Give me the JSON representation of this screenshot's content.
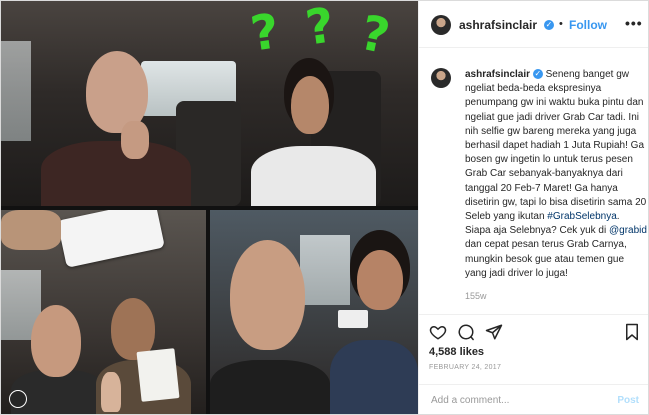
{
  "post": {
    "username": "ashrafsinclair",
    "verified_symbol": "✓",
    "separator": "•",
    "follow_label": "Follow",
    "more_symbol": "•••",
    "caption_prefix": "Seneng banget gw ngeliat beda-beda ekspresinya penumpang gw ini waktu buka pintu dan ngeliat gue jadi driver Grab Car tadi. Ini nih selfie gw bareng mereka yang juga berhasil dapet hadiah 1 Juta Rupiah! Ga bosen gw ingetin lo untuk terus pesen Grab Car sebanyak-banyaknya dari tanggal 20 Feb-7 Maret! Ga hanya disetirin gw, tapi lo bisa disetirin sama 20 Seleb yang ikutan ",
    "hashtag": "#GrabSelebnya",
    "caption_mid": ". Siapa aja Selebnya? Cek yuk di ",
    "mention": "@grabid",
    "caption_suffix": " dan cepat pesan terus Grab Carnya, mungkin besok gue atau temen gue yang jadi driver lo juga!",
    "time_ago": "155w",
    "likes": "4,588 likes",
    "date": "FEBRUARY 24, 2017",
    "add_comment_placeholder": "Add a comment...",
    "post_label": "Post"
  },
  "media": {
    "overlay_marks": [
      "?",
      "?",
      "?"
    ],
    "overlay_color": "#39d62c"
  },
  "icons": [
    "heart-icon",
    "comment-icon",
    "share-icon",
    "bookmark-icon",
    "user-tag-icon",
    "verified-badge-icon"
  ],
  "colors": {
    "link": "#003569",
    "follow": "#3897f0",
    "muted": "#999999"
  }
}
